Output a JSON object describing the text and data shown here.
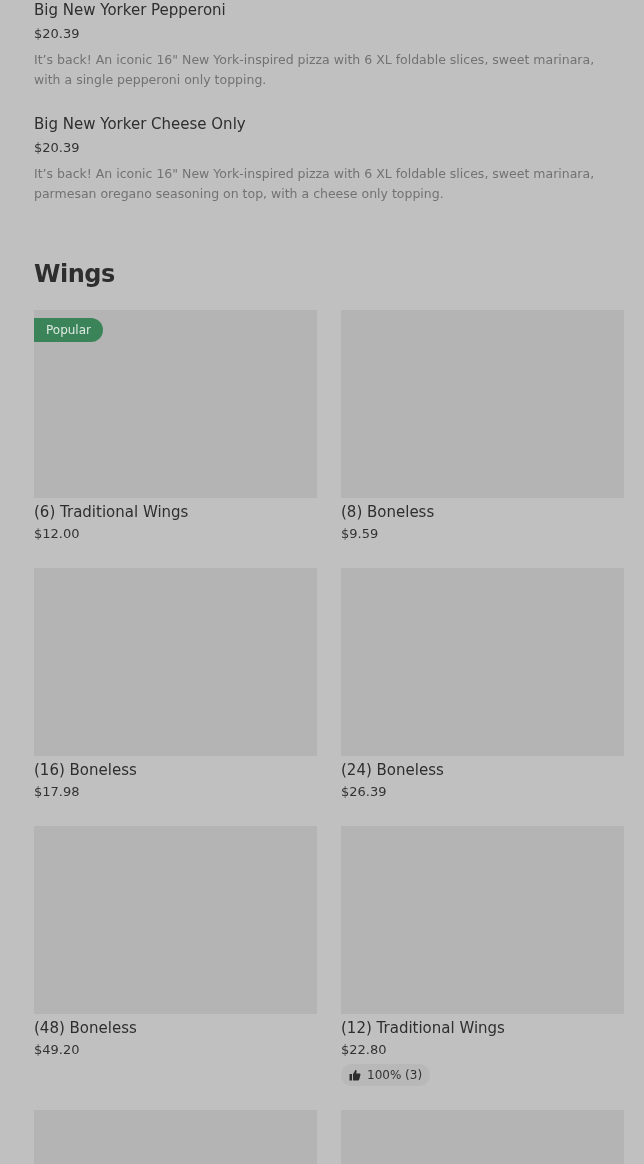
{
  "menu_items": [
    {
      "name": "Big New Yorker Pepperoni",
      "price": "$20.39",
      "description": "It’s back! An iconic 16\" New York-inspired pizza with 6 XL foldable slices, sweet marinara, with a single pepperoni only topping."
    },
    {
      "name": "Big New Yorker Cheese Only",
      "price": "$20.39",
      "description": "It’s back! An iconic 16\" New York-inspired pizza with 6 XL foldable slices, sweet marinara, parmesan oregano seasoning on top, with a cheese only topping."
    }
  ],
  "section": {
    "title": "Wings",
    "items": [
      {
        "kind": "dish",
        "badge": "Popular",
        "name": "(6) Traditional Wings",
        "price": "$12.00"
      },
      {
        "kind": "dish",
        "name": "(8) Boneless",
        "price": "$9.59"
      },
      {
        "kind": "dish",
        "name": "(16) Boneless",
        "price": "$17.98"
      },
      {
        "kind": "dish",
        "name": "(24) Boneless",
        "price": "$26.39"
      },
      {
        "kind": "dish",
        "name": "(48) Boneless",
        "price": "$49.20"
      },
      {
        "kind": "dish",
        "name": "(12) Traditional Wings",
        "price": "$22.80",
        "rating": "100% (3)"
      },
      {
        "kind": "dish"
      },
      {
        "kind": "dish"
      }
    ]
  }
}
